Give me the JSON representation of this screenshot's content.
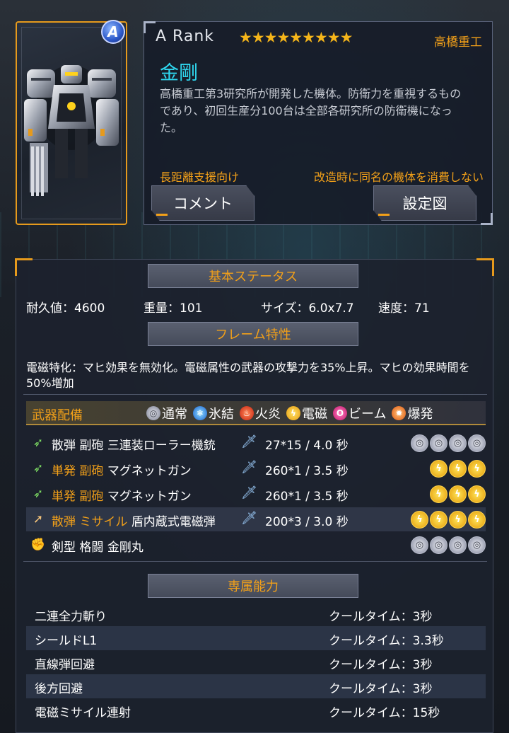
{
  "unit": {
    "rank": "A  Rank",
    "rank_badge": "A",
    "stars": "★★★★★★★★★",
    "maker": "高橋重工",
    "name": "金剛",
    "description": "高橋重工第3研究所が開発した機体。防衛力を重視するものであり、初回生産分100台は全部各研究所の防衛機になった。",
    "role_tag": "長距離支援向け",
    "upgrade_note": "改造時に同名の機体を消費しない",
    "comment_button": "コメント",
    "design_button": "設定図"
  },
  "basic_status": {
    "heading": "基本ステータス",
    "durability": "耐久値：4600",
    "weight": "重量：101",
    "size": "サイズ：6.0x7.7",
    "speed": "速度：71"
  },
  "frame": {
    "heading": "フレーム特性",
    "text": "電磁特化：マヒ効果を無効化。電磁属性の武器の攻撃力を35%上昇。マヒの効果時間を50%増加"
  },
  "weapons": {
    "heading": "武器配備",
    "legend": [
      {
        "icon": "normal",
        "label": "通常"
      },
      {
        "icon": "ice",
        "label": "氷結"
      },
      {
        "icon": "fire",
        "label": "火炎"
      },
      {
        "icon": "elec",
        "label": "電磁"
      },
      {
        "icon": "beam",
        "label": "ビーム"
      },
      {
        "icon": "blast",
        "label": "爆発"
      }
    ],
    "rows": [
      {
        "icon": "rifle-icon",
        "type": "散弾 副砲",
        "name": "三連装ローラー機銃",
        "damage": "27*15 / 4.0 秒",
        "slots": [
          "normal",
          "normal",
          "normal",
          "normal"
        ]
      },
      {
        "icon": "rifle-icon",
        "type": "単発 副砲",
        "name": "マグネットガン",
        "damage": "260*1 / 3.5 秒",
        "slots": [
          "elec",
          "elec",
          "elec"
        ]
      },
      {
        "icon": "rifle-icon",
        "type": "単発 副砲",
        "name": "マグネットガン",
        "damage": "260*1 / 3.5 秒",
        "slots": [
          "elec",
          "elec",
          "elec"
        ]
      },
      {
        "icon": "missile-icon",
        "type": "散弾 ミサイル",
        "name": "盾内蔵式電磁弾",
        "damage": "200*3 / 3.0 秒",
        "slots": [
          "elec",
          "elec",
          "elec",
          "elec"
        ]
      },
      {
        "icon": "fist-icon",
        "type": "剣型 格闘",
        "name": "金剛丸",
        "damage": "",
        "slots": [
          "normal",
          "normal",
          "normal",
          "normal"
        ]
      }
    ]
  },
  "abilities": {
    "heading": "専属能力",
    "rows": [
      {
        "name": "二連全力斬り",
        "cooldown": "クールタイム：3秒"
      },
      {
        "name": "シールドL1",
        "cooldown": "クールタイム：3.3秒"
      },
      {
        "name": "直線弾回避",
        "cooldown": "クールタイム：3秒"
      },
      {
        "name": "後方回避",
        "cooldown": "クールタイム：3秒"
      },
      {
        "name": "電磁ミサイル連射",
        "cooldown": "クールタイム：15秒"
      }
    ]
  },
  "colors": {
    "accent": "#f2a019",
    "name": "#2fd8f0",
    "frame": "#e69a1c"
  }
}
